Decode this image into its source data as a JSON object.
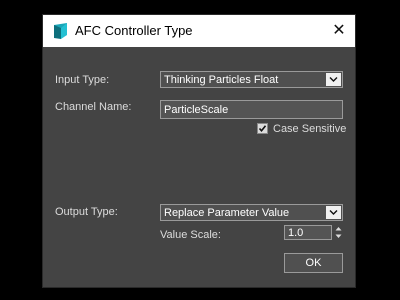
{
  "window": {
    "title": "AFC Controller Type",
    "close_glyph": "✕",
    "app_icon": "3ds-max-icon"
  },
  "form": {
    "input_type_label": "Input Type:",
    "input_type_value": "Thinking Particles Float",
    "channel_name_label": "Channel Name:",
    "channel_name_value": "ParticleScale",
    "case_sensitive_label": "Case Sensitive",
    "case_sensitive_checked": true,
    "output_type_label": "Output Type:",
    "output_type_value": "Replace Parameter Value",
    "value_scale_label": "Value Scale:",
    "value_scale_value": "1.0",
    "ok_label": "OK"
  },
  "colors": {
    "dialog_background": "#444444",
    "titlebar_background": "#ffffff",
    "icon_teal": "#1aa6b8"
  }
}
